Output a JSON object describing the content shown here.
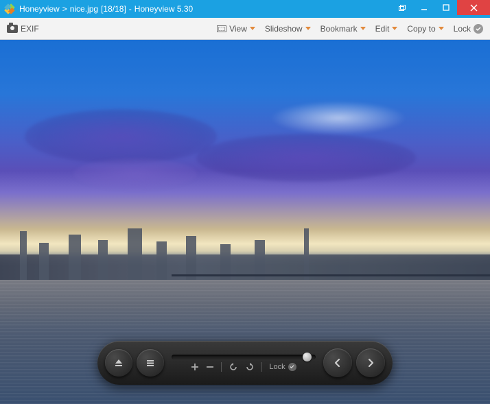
{
  "titlebar": {
    "app_name": "Honeyview",
    "separator": ">",
    "filename": "nice.jpg",
    "counter": "[18/18]",
    "dash": "-",
    "app_version": "Honeyview 5.30"
  },
  "toolbar": {
    "exif_label": "EXIF",
    "view_label": "View",
    "slideshow_label": "Slideshow",
    "bookmark_label": "Bookmark",
    "edit_label": "Edit",
    "copyto_label": "Copy to",
    "lock_label": "Lock"
  },
  "controls": {
    "lock_label": "Lock"
  }
}
